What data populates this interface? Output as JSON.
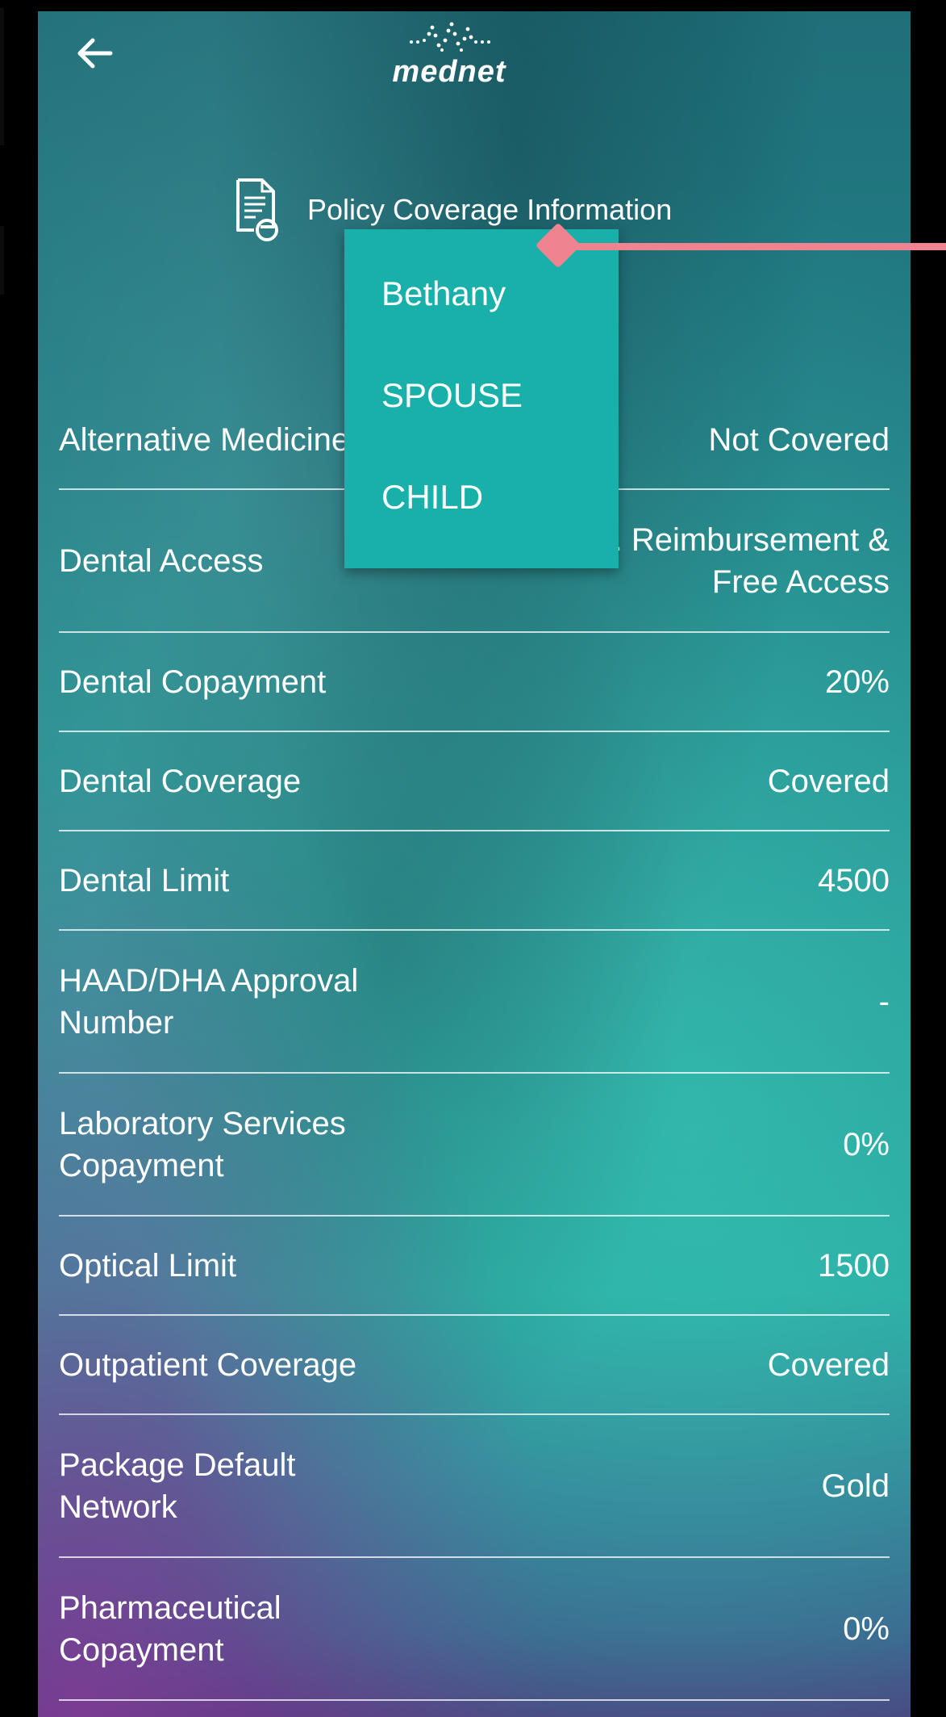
{
  "app": {
    "logo_text": "mednet"
  },
  "header": {
    "title": "Policy Coverage Information",
    "back_icon": "arrow-left-icon",
    "doc_icon": "document-search-icon"
  },
  "dropdown": {
    "items": [
      {
        "label": "Bethany"
      },
      {
        "label": "SPOUSE"
      },
      {
        "label": "CHILD"
      }
    ]
  },
  "coverage": {
    "rows": [
      {
        "label": "Alternative Medicine",
        "value": "Not Covered"
      },
      {
        "label": "Dental Access",
        "value": "02. Reimbursement & Free Access"
      },
      {
        "label": "Dental Copayment",
        "value": "20%"
      },
      {
        "label": "Dental Coverage",
        "value": "Covered"
      },
      {
        "label": "Dental Limit",
        "value": "4500"
      },
      {
        "label": "HAAD/DHA Approval Number",
        "value": "-"
      },
      {
        "label": "Laboratory Services Copayment",
        "value": "0%"
      },
      {
        "label": "Optical Limit",
        "value": "1500"
      },
      {
        "label": "Outpatient Coverage",
        "value": "Covered"
      },
      {
        "label": "Package Default Network",
        "value": "Gold"
      },
      {
        "label": "Pharmaceutical Copayment",
        "value": "0%"
      }
    ]
  },
  "colors": {
    "dropdown_bg": "#18b0a8",
    "callout": "#ef8490"
  }
}
